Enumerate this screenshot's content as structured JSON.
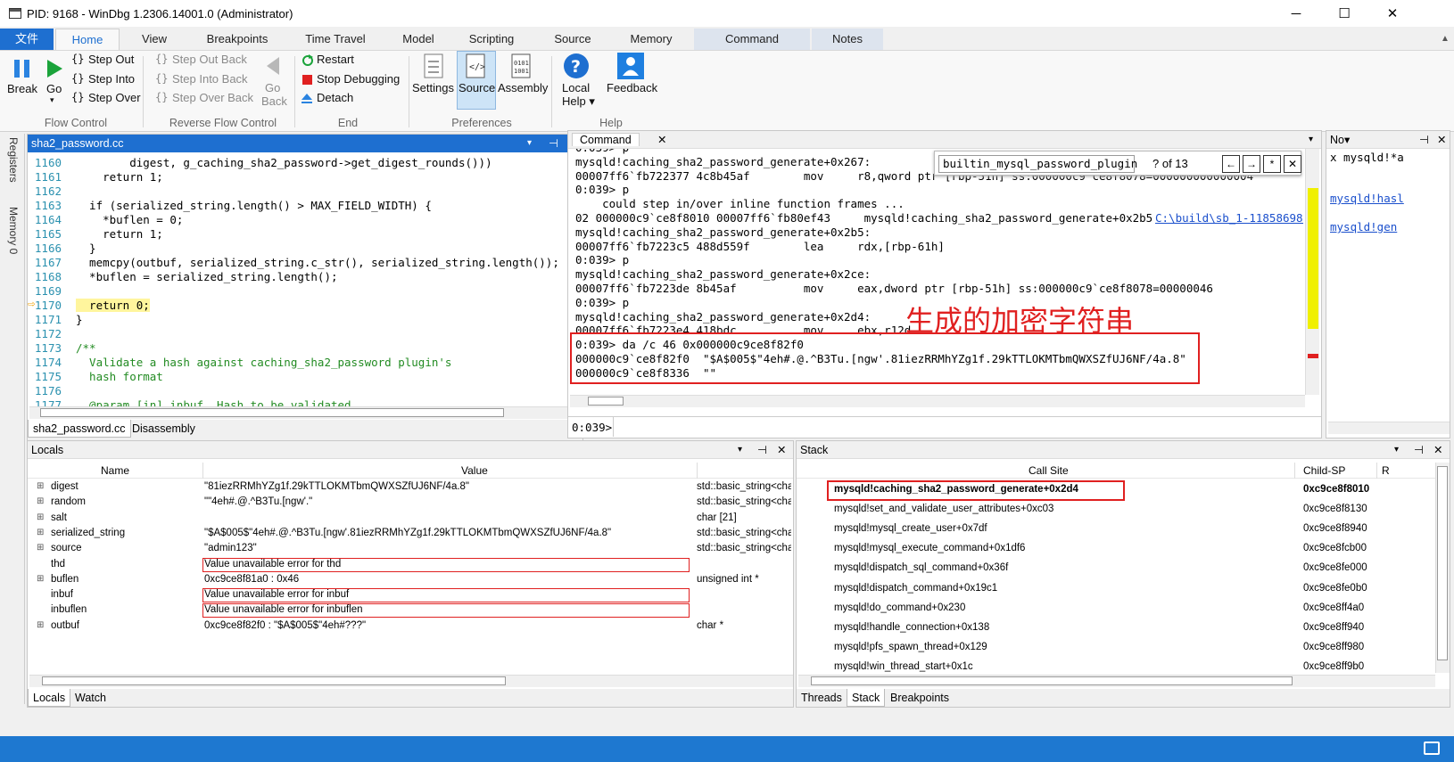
{
  "window": {
    "title": "PID: 9168 - WinDbg 1.2306.14001.0 (Administrator)"
  },
  "ribbon_tabs": [
    "文件",
    "Home",
    "View",
    "Breakpoints",
    "Time Travel",
    "Model",
    "Scripting",
    "Source",
    "Memory",
    "Command",
    "Notes"
  ],
  "ribbon": {
    "break": "Break",
    "go": "Go",
    "step_out": "Step Out",
    "step_into": "Step Into",
    "step_over": "Step Over",
    "step_out_back": "Step Out Back",
    "step_into_back": "Step Into Back",
    "step_over_back": "Step Over Back",
    "go_back_1": "Go",
    "go_back_2": "Back",
    "restart": "Restart",
    "stop": "Stop Debugging",
    "detach": "Detach",
    "settings": "Settings",
    "source": "Source",
    "assembly": "Assembly",
    "local_help_1": "Local",
    "local_help_2": "Help ▾",
    "feedback": "Feedback",
    "groups": {
      "flow": "Flow Control",
      "reverse": "Reverse Flow Control",
      "end": "End",
      "prefs": "Preferences",
      "help": "Help"
    }
  },
  "side_tabs": {
    "registers": "Registers",
    "memory": "Memory 0"
  },
  "source_panel": {
    "title": "sha2_password.cc",
    "lines": [
      {
        "n": "1160",
        "t": "        digest, g_caching_sha2_password->get_digest_rounds()))"
      },
      {
        "n": "1161",
        "t": "    return 1;"
      },
      {
        "n": "1162",
        "t": ""
      },
      {
        "n": "1163",
        "t": "  if (serialized_string.length() > MAX_FIELD_WIDTH) {"
      },
      {
        "n": "1164",
        "t": "    *buflen = 0;"
      },
      {
        "n": "1165",
        "t": "    return 1;"
      },
      {
        "n": "1166",
        "t": "  }"
      },
      {
        "n": "1167",
        "t": "  memcpy(outbuf, serialized_string.c_str(), serialized_string.length());"
      },
      {
        "n": "1168",
        "t": "  *buflen = serialized_string.length();"
      },
      {
        "n": "1169",
        "t": ""
      },
      {
        "n": "1170",
        "t": "  return 0;"
      },
      {
        "n": "1171",
        "t": "}"
      },
      {
        "n": "1172",
        "t": ""
      },
      {
        "n": "1173",
        "t": "/**"
      },
      {
        "n": "1174",
        "t": "  Validate a hash against caching_sha2_password plugin's"
      },
      {
        "n": "1175",
        "t": "  hash format"
      },
      {
        "n": "1176",
        "t": ""
      },
      {
        "n": "1177",
        "t": "  @param [in] inbuf  Hash to be validated"
      }
    ],
    "tabs": [
      "sha2_password.cc",
      "Disassembly"
    ]
  },
  "command_panel": {
    "title": "Command",
    "search": {
      "value": "builtin_mysql_password_plugin",
      "count": "? of 13"
    },
    "lines": [
      "0:039> p",
      "mysqld!caching_sha2_password_generate+0x267:",
      "00007ff6`fb722377 4c8b45af        mov     r8,qword ptr [rbp-51h] ss:000000c9`ce8f8078=000000000000004",
      "0:039> p",
      "    could step in/over inline function frames ...",
      "02 000000c9`ce8f8010 00007ff6`fb80ef43     mysqld!caching_sha2_password_generate+0x2b5 ",
      "mysqld!caching_sha2_password_generate+0x2b5:",
      "00007ff6`fb7223c5 488d559f        lea     rdx,[rbp-61h]",
      "0:039> p",
      "mysqld!caching_sha2_password_generate+0x2ce:",
      "00007ff6`fb7223de 8b45af          mov     eax,dword ptr [rbp-51h] ss:000000c9`ce8f8078=00000046",
      "0:039> p",
      "mysqld!caching_sha2_password_generate+0x2d4:",
      "00007ff6`fb7223e4 418bdc          mov     ebx,r12d",
      "0:039> da /c 46 0x000000c9ce8f82f0",
      "000000c9`ce8f82f0  \"$A$005$\"4eh#.@.^B3Tu.[ngw'.81iezRRMhYZg1f.29kTTLOKMTbmQWXSZfUJ6NF/4a.8\"",
      "000000c9`ce8f8336  \"\""
    ],
    "link": "C:\\build\\sb_1-11858698-",
    "annotation": "生成的加密字符串",
    "prompt": "0:039>"
  },
  "notes_panel": {
    "title": "No▾",
    "lines": [
      "x mysqld!*a",
      "mysqld!hasl",
      "mysqld!gen"
    ]
  },
  "locals_panel": {
    "title": "Locals",
    "headers": {
      "name": "Name",
      "value": "Value"
    },
    "rows": [
      {
        "exp": "⊞",
        "name": "digest",
        "value": "\"81iezRRMhYZg1f.29kTTLOKMTbmQWXSZfUJ6NF/4a.8\"",
        "type": "std::basic_string<cha"
      },
      {
        "exp": "⊞",
        "name": "random",
        "value": "\"\"4eh#.@.^B3Tu.[ngw'.\"",
        "type": "std::basic_string<cha"
      },
      {
        "exp": "⊞",
        "name": "salt",
        "value": "",
        "type": "char [21]"
      },
      {
        "exp": "⊞",
        "name": "serialized_string",
        "value": "\"$A$005$\"4eh#.@.^B3Tu.[ngw'.81iezRRMhYZg1f.29kTTLOKMTbmQWXSZfUJ6NF/4a.8\"",
        "type": "std::basic_string<cha"
      },
      {
        "exp": "⊞",
        "name": "source",
        "value": "\"admin123\"",
        "type": "std::basic_string<cha"
      },
      {
        "exp": "",
        "name": "thd",
        "value": "Value unavailable error for thd",
        "type": ""
      },
      {
        "exp": "⊞",
        "name": "buflen",
        "value": "0xc9ce8f81a0 : 0x46",
        "type": "unsigned int *"
      },
      {
        "exp": "",
        "name": "inbuf",
        "value": "Value unavailable error for inbuf",
        "type": ""
      },
      {
        "exp": "",
        "name": "inbuflen",
        "value": "Value unavailable error for inbuflen",
        "type": ""
      },
      {
        "exp": "⊞",
        "name": "outbuf",
        "value": "0xc9ce8f82f0 : \"$A$005$\"4eh#???\"",
        "type": "char *"
      }
    ],
    "tabs": [
      "Locals",
      "Watch"
    ]
  },
  "stack_panel": {
    "title": "Stack",
    "headers": {
      "call_site": "Call Site",
      "child_sp": "Child-SP",
      "extra": "R"
    },
    "rows": [
      {
        "site": "mysqld!caching_sha2_password_generate+0x2d4",
        "sp": "0xc9ce8f8010"
      },
      {
        "site": "mysqld!set_and_validate_user_attributes+0xc03",
        "sp": "0xc9ce8f8130"
      },
      {
        "site": "mysqld!mysql_create_user+0x7df",
        "sp": "0xc9ce8f8940"
      },
      {
        "site": "mysqld!mysql_execute_command+0x1df6",
        "sp": "0xc9ce8fcb00"
      },
      {
        "site": "mysqld!dispatch_sql_command+0x36f",
        "sp": "0xc9ce8fe000"
      },
      {
        "site": "mysqld!dispatch_command+0x19c1",
        "sp": "0xc9ce8fe0b0"
      },
      {
        "site": "mysqld!do_command+0x230",
        "sp": "0xc9ce8ff4a0"
      },
      {
        "site": "mysqld!handle_connection+0x138",
        "sp": "0xc9ce8ff940"
      },
      {
        "site": "mysqld!pfs_spawn_thread+0x129",
        "sp": "0xc9ce8ff980"
      },
      {
        "site": "mysqld!win_thread_start+0x1c",
        "sp": "0xc9ce8ff9b0"
      }
    ],
    "tabs": [
      "Threads",
      "Stack",
      "Breakpoints"
    ]
  },
  "glyphs": {
    "minimize": "─",
    "maximize": "☐",
    "close": "✕",
    "dropdown": "▾",
    "pin": "⊣",
    "up": "▲",
    "down": "▼",
    "left": "◀",
    "right": "▶",
    "prev": "←",
    "next": "→",
    "regex": "*",
    "expand": "⊞",
    "arrow": "⇨"
  },
  "colors": {
    "accent": "#0078d7",
    "error_box": "#e02020",
    "annotation": "#e02020"
  }
}
